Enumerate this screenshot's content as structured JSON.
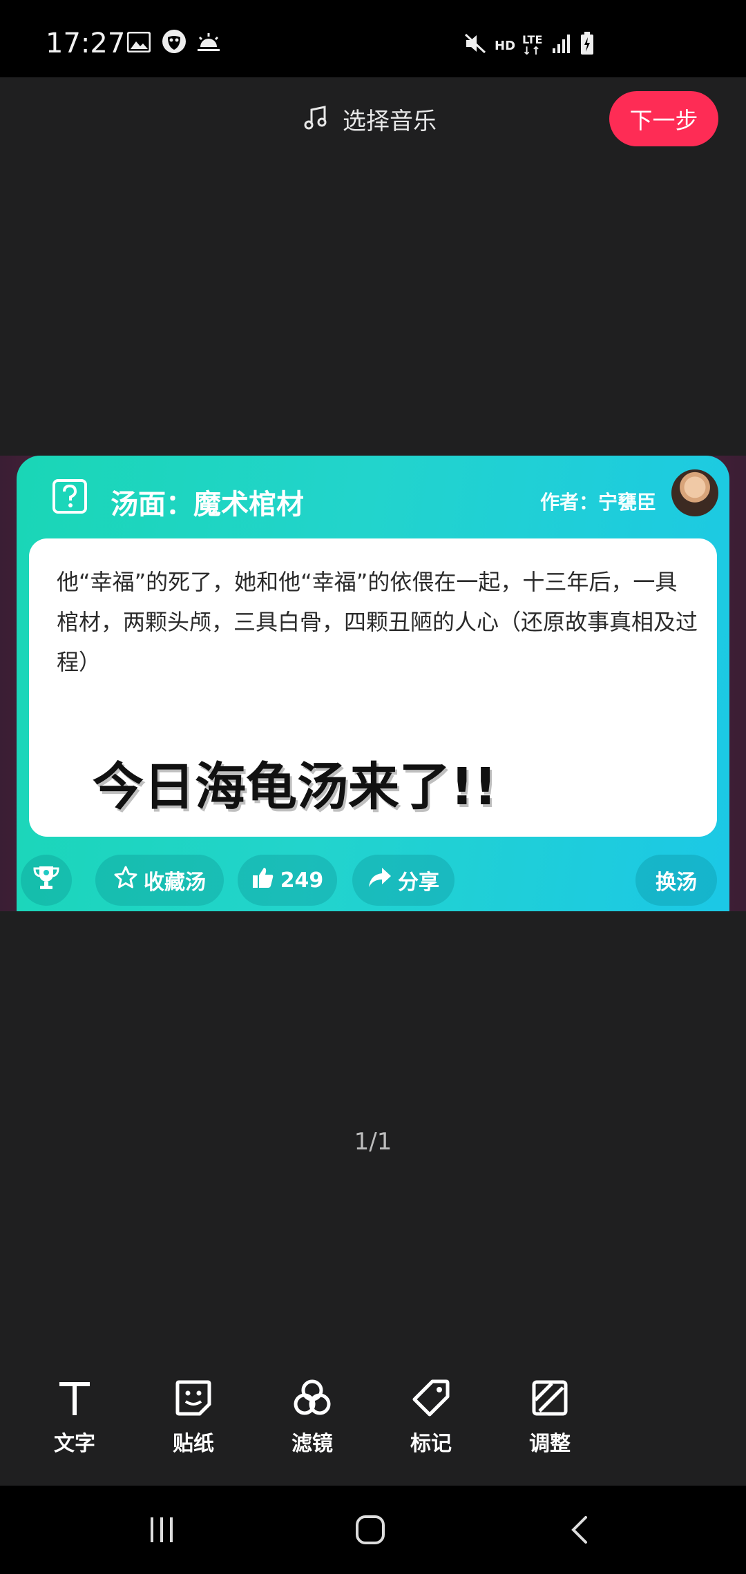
{
  "status": {
    "time": "17:27",
    "network": "HD",
    "lte": "LTE"
  },
  "topbar": {
    "music_label": "选择音乐",
    "next_label": "下一步"
  },
  "card": {
    "title": "汤面：魔术棺材",
    "author": "作者：宁甕臣",
    "story": "他“幸福”的死了，她和他“幸福”的依偎在一起，十三年后，一具棺材，两颗头颅，三具白骨，四颗丑陋的人心（还原故事真相及过程）",
    "headline": "今日海龟汤来了!!",
    "actions": {
      "collect_label": "收藏汤",
      "like_count": "249",
      "share_label": "分享",
      "switch_label": "换汤"
    }
  },
  "page_counter": "1/1",
  "tools": [
    {
      "label": "文字",
      "icon": "text-icon"
    },
    {
      "label": "贴纸",
      "icon": "sticker-icon"
    },
    {
      "label": "滤镜",
      "icon": "filter-icon"
    },
    {
      "label": "标记",
      "icon": "tag-icon"
    },
    {
      "label": "调整",
      "icon": "adjust-icon"
    }
  ],
  "colors": {
    "accent": "#fe2c55",
    "card_start": "#1ad6b6",
    "card_end": "#1cc8e6",
    "background": "#1f1f20"
  }
}
